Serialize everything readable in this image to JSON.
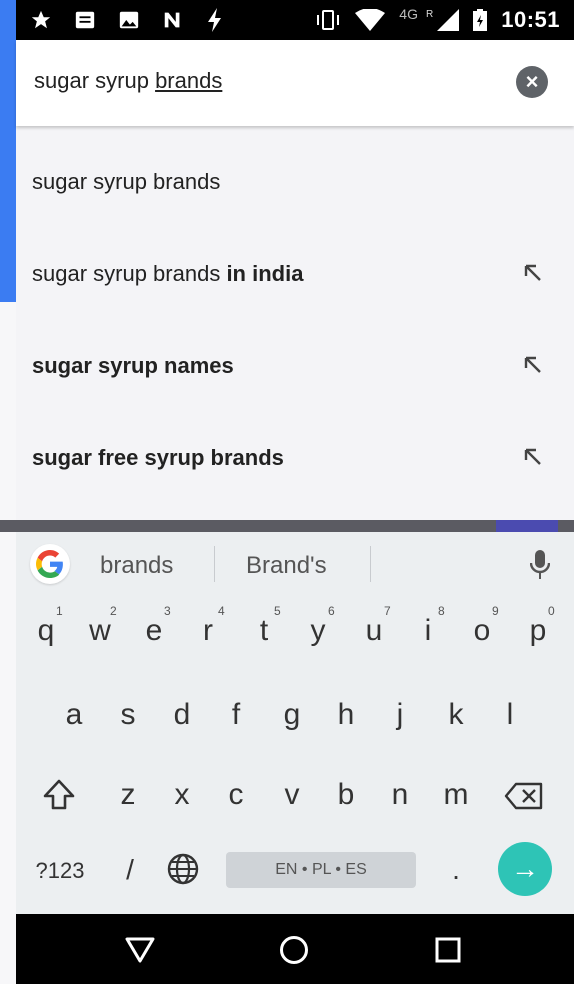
{
  "status_bar": {
    "time": "10:51",
    "network": "4G",
    "roaming": "R",
    "icons": [
      "star-icon",
      "message-icon",
      "image-icon",
      "n-icon",
      "bolt-icon",
      "vibrate-icon",
      "wifi-icon",
      "signal-icon",
      "battery-icon"
    ]
  },
  "search": {
    "prefix": "sugar syrup ",
    "underlined": "brands",
    "clear_label": "×"
  },
  "suggestions": [
    {
      "plain": "sugar syrup brands",
      "bold": ""
    },
    {
      "plain": "sugar syrup brands ",
      "bold": "in india"
    },
    {
      "plain": "",
      "bold": "sugar syrup names"
    },
    {
      "plain": "",
      "bold": "sugar free syrup brands"
    }
  ],
  "keyboard": {
    "word_suggestions": [
      "brands",
      "Brand's"
    ],
    "row1": [
      {
        "k": "q",
        "n": "1"
      },
      {
        "k": "w",
        "n": "2"
      },
      {
        "k": "e",
        "n": "3"
      },
      {
        "k": "r",
        "n": "4"
      },
      {
        "k": "t",
        "n": "5"
      },
      {
        "k": "y",
        "n": "6"
      },
      {
        "k": "u",
        "n": "7"
      },
      {
        "k": "i",
        "n": "8"
      },
      {
        "k": "o",
        "n": "9"
      },
      {
        "k": "p",
        "n": "0"
      }
    ],
    "row2": [
      "a",
      "s",
      "d",
      "f",
      "g",
      "h",
      "j",
      "k",
      "l"
    ],
    "row3": [
      "z",
      "x",
      "c",
      "v",
      "b",
      "n",
      "m"
    ],
    "symbols_label": "?123",
    "slash_label": "/",
    "period_label": ".",
    "space_label": "EN • PL • ES",
    "enter_label": "→",
    "accent_color": "#2ec4b6"
  }
}
